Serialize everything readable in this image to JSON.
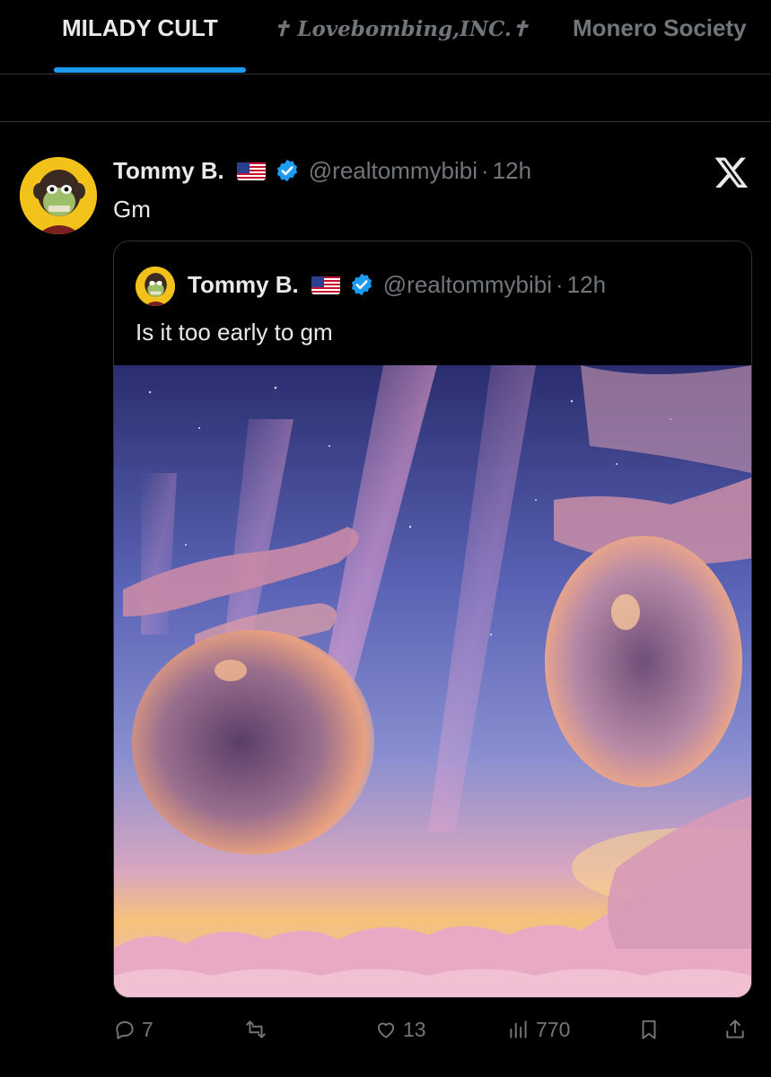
{
  "tabs": [
    {
      "label": "MILADY CULT",
      "active": true
    },
    {
      "label": "✝ Lovebombing,INC.✝",
      "active": false
    },
    {
      "label": "Monero Society",
      "active": false
    }
  ],
  "post": {
    "author_name": "Tommy B.",
    "flag": "us-flag",
    "verified": true,
    "handle": "@realtommybibi",
    "separator": "·",
    "time": "12h",
    "text": "Gm",
    "platform_icon": "x-logo-icon",
    "quote": {
      "author_name": "Tommy B.",
      "handle": "@realtommybibi",
      "separator": "·",
      "time": "12h",
      "text": "Is it too early to gm"
    },
    "actions": {
      "replies": "7",
      "reposts": "",
      "likes": "13",
      "views": "770"
    }
  },
  "colors": {
    "background": "#000000",
    "accent": "#1d9bf0",
    "muted": "#71767b",
    "text": "#e7e9ea",
    "border": "#2f3336"
  }
}
